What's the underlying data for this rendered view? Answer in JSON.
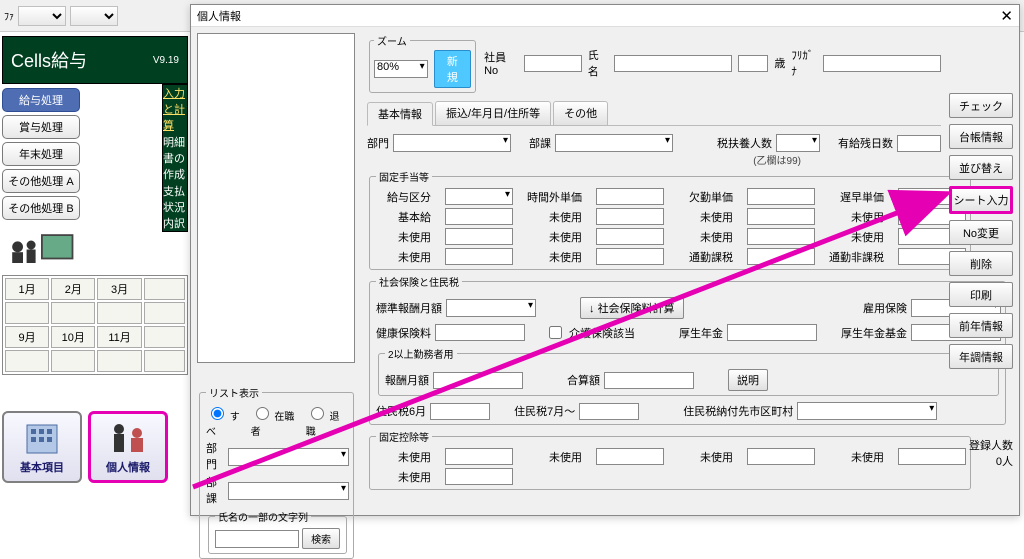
{
  "app": {
    "brand": "Cells給与",
    "version": "V9.19"
  },
  "dialog_title": "個人情報",
  "side_tabs": [
    "給与処理",
    "賞与処理",
    "年末処理",
    "その他処理 A",
    "その他処理 B"
  ],
  "green_links": {
    "a": "入力と計算",
    "b": "明細書の作成",
    "c": "支払状況内訳"
  },
  "months": {
    "row1": [
      "1月",
      "2月",
      "3月",
      ""
    ],
    "row2": [
      "9月",
      "10月",
      "11月",
      ""
    ]
  },
  "big_buttons": {
    "basic": "基本項目",
    "person": "個人情報"
  },
  "zoom": {
    "legend": "ズーム",
    "value": "80%",
    "new": "新規"
  },
  "idrow": {
    "emp_no": "社員No",
    "name": "氏名",
    "age": "歳",
    "kana": "ﾌﾘｶﾞﾅ"
  },
  "tabs": [
    "基本情報",
    "振込/年月日/住所等",
    "その他"
  ],
  "toprow": {
    "bumon": "部門",
    "busho": "部課",
    "fuyou": "税扶養人数",
    "fuyou_note": "(乙欄は99)",
    "yukyu": "有給残日数"
  },
  "kotei": {
    "legend": "固定手当等",
    "row0": [
      "給与区分",
      "時間外単価",
      "欠勤単価",
      "遅早単価"
    ],
    "row1": [
      "基本給",
      "未使用",
      "未使用",
      "未使用"
    ],
    "row2": [
      "未使用",
      "未使用",
      "未使用",
      "未使用"
    ],
    "row3": [
      "未使用",
      "未使用",
      "通勤課税",
      "通勤非課税"
    ]
  },
  "shakai": {
    "legend": "社会保険と住民税",
    "hyojun": "標準報酬月額",
    "keisan_btn_prefix": "↓",
    "keisan_btn": "社会保険料計算",
    "koyo": "雇用保険",
    "kenko": "健康保険料",
    "kaigo": "介護保険該当",
    "kousei": "厚生年金",
    "kikin": "厚生年金基金",
    "ni": {
      "legend": "2以上勤務者用",
      "hoshu": "報酬月額",
      "gassan": "合算額",
      "setsumei": "説明"
    },
    "ju6": "住民税6月",
    "ju7": "住民税7月～",
    "ju_city": "住民税納付先市区町村"
  },
  "koteikojo": {
    "legend": "固定控除等",
    "lbl": "未使用"
  },
  "list": {
    "legend": "リスト表示",
    "opts": [
      "すべ",
      "在職者",
      "退職"
    ],
    "bumon": "部門",
    "busho": "部課",
    "name_leg": "氏名の一部の文字列",
    "search": "検索"
  },
  "rbtns": [
    "チェック",
    "台帳情報",
    "並び替え",
    "シート入力",
    "No変更",
    "削除",
    "印刷",
    "前年情報",
    "年調情報"
  ],
  "reg": {
    "lbl": "登録人数",
    "val": "0人"
  }
}
